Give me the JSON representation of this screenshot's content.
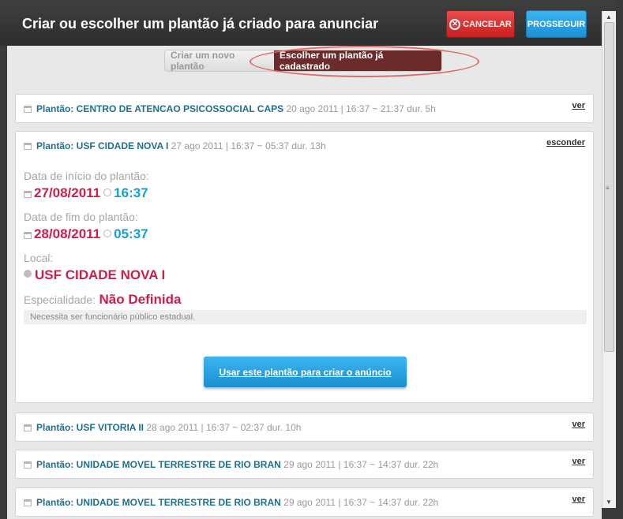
{
  "header": {
    "title": "Criar ou escolher um plantão já criado para anunciar",
    "cancel_label": "CANCELAR",
    "next_label": "PROSSEGUIR"
  },
  "tabs": {
    "new_label": "Criar um novo plantão",
    "existing_label": "Escolher um plantão já cadastrado"
  },
  "cards": [
    {
      "title": "Plantão: CENTRO DE ATENCAO PSICOSSOCIAL CAPS",
      "meta": "20 ago 2011 | 16:37 ~ 21:37 dur. 5h",
      "link": "ver"
    },
    {
      "title": "Plantão: USF CIDADE NOVA I",
      "meta": "27 ago 2011 | 16:37 ~ 05:37 dur. 13h",
      "link": "esconder"
    },
    {
      "title": "Plantão: USF VITORIA II",
      "meta": "28 ago 2011 | 16:37 ~ 02:37 dur. 10h",
      "link": "ver"
    },
    {
      "title": "Plantão: UNIDADE MOVEL TERRESTRE DE RIO BRAN",
      "meta": "29 ago 2011 | 16:37 ~ 14:37 dur. 22h",
      "link": "ver"
    },
    {
      "title": "Plantão: UNIDADE MOVEL TERRESTRE DE RIO BRAN",
      "meta": "29 ago 2011 | 16:37 ~ 14:37 dur. 22h",
      "link": "ver"
    }
  ],
  "detail": {
    "start_label": "Data de início do plantão:",
    "start_date": "27/08/2011",
    "start_time": "16:37",
    "end_label": "Data de fim do plantão:",
    "end_date": "28/08/2011",
    "end_time": "05:37",
    "local_label": "Local:",
    "local_value": "USF CIDADE NOVA I",
    "spec_label": "Especialidade:",
    "spec_value": "Não Definida",
    "note": "Necessita ser funcionário público estadual.",
    "use_button": "Usar este plantão para criar o anúncio"
  },
  "colors": {
    "cancel": "#d93030",
    "proceed": "#1f9ee0",
    "selected_tab": "#6b2b2b",
    "date_red": "#cc1e4a",
    "time_blue": "#159fd6",
    "title_blue": "#1f6f8f"
  }
}
